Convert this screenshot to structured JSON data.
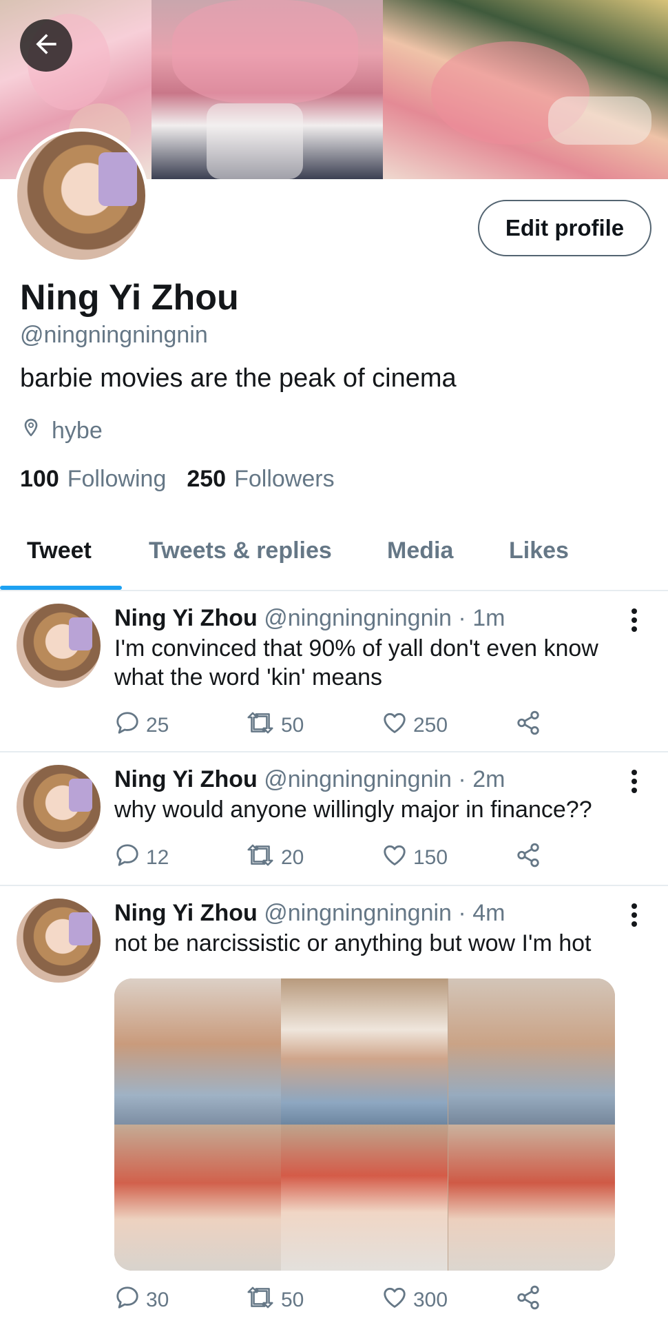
{
  "profile": {
    "name": "Ning Yi Zhou",
    "handle": "@ningningningnin",
    "bio": "barbie movies are the peak of cinema",
    "location": "hybe",
    "following_count": "100",
    "following_label": "Following",
    "followers_count": "250",
    "followers_label": "Followers",
    "edit_button": "Edit profile"
  },
  "tabs": [
    {
      "label": "Tweet",
      "active": true
    },
    {
      "label": "Tweets & replies",
      "active": false
    },
    {
      "label": "Media",
      "active": false
    },
    {
      "label": "Likes",
      "active": false
    }
  ],
  "tweets": [
    {
      "author": "Ning Yi Zhou",
      "handle": "@ningningningnin",
      "time": "1m",
      "text": "I'm convinced that 90% of yall don't even know what the word 'kin' means",
      "replies": "25",
      "retweets": "50",
      "likes": "250"
    },
    {
      "author": "Ning Yi Zhou",
      "handle": "@ningningningnin",
      "time": "2m",
      "text": "why would anyone willingly major in finance??",
      "replies": "12",
      "retweets": "20",
      "likes": "150"
    },
    {
      "author": "Ning Yi Zhou",
      "handle": "@ningningningnin",
      "time": "4m",
      "text": "not be narcissistic or anything but wow I'm hot",
      "replies": "30",
      "retweets": "50",
      "likes": "300"
    }
  ],
  "icons": {
    "back": "arrow-left-icon",
    "location": "location-pin-icon",
    "reply": "comment-icon",
    "retweet": "retweet-icon",
    "like": "heart-icon",
    "share": "share-icon",
    "more": "more-vertical-icon"
  },
  "colors": {
    "accent": "#1da1f2",
    "secondary_text": "#657786",
    "primary_text": "#14171a",
    "divider": "#e6ecf0"
  }
}
